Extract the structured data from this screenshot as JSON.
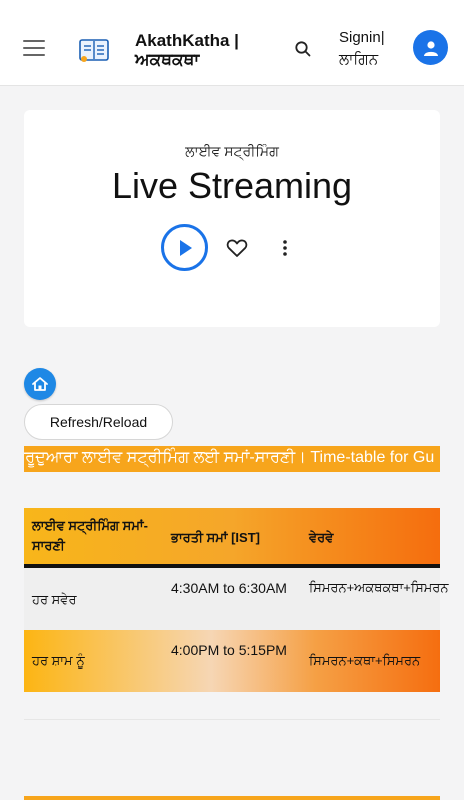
{
  "header": {
    "brand_line1": "AkathKatha |",
    "brand_line2": "ਅਕਥਕਥਾ",
    "signin_line1": "Signin|",
    "signin_line2": "ਲਾਗਿਨ"
  },
  "player": {
    "subtitle": "ਲਾਈਵ ਸਟ੍ਰੀਮਿੰਗ",
    "title": "Live Streaming"
  },
  "refresh_label": "Refresh/Reload",
  "marquee_text": "ਗੁਰੂਦੁਆਰਾ ਲਾਈਵ ਸਟ੍ਰੀਮਿੰਗ ਲਈ ਸਮਾਂ-ਸਾਰਣੀ। Time-table for Gu",
  "schedule": {
    "headers": [
      "ਲਾਈਵ ਸਟ੍ਰੀਮਿੰਗ ਸਮਾਂ-ਸਾਰਣੀ",
      "ਭਾਰਤੀ ਸਮਾਂ [IST]",
      "ਵੇਰਵੇ"
    ],
    "rows": [
      [
        "ਹਰ ਸਵੇਰ",
        "4:30AM to 6:30AM",
        "ਸਿਮਰਨ+ਅਕਥਕਥਾ+ਸਿਮਰਨ"
      ],
      [
        "ਹਰ ਸ਼ਾਮ ਨੂੰ",
        "4:00PM to 5:15PM",
        "ਸਿਮਰਨ+ਕਥਾ+ਸਿਮਰਨ"
      ]
    ]
  },
  "icons": {
    "menu": "hamburger-icon",
    "logo": "book-logo-icon",
    "search": "search-icon",
    "account": "account-icon",
    "play": "play-icon",
    "favorite": "heart-icon",
    "more": "more-vert-icon",
    "home": "home-icon"
  },
  "colors": {
    "accent": "#1a73e8",
    "orange": "#f7a51c",
    "deep_orange": "#f56d0e"
  }
}
